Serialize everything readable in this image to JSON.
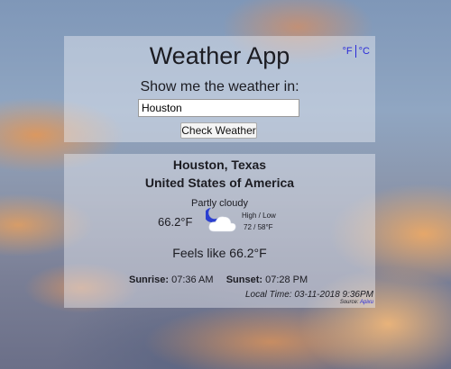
{
  "app": {
    "title": "Weather App",
    "prompt": "Show me the weather in:"
  },
  "units": {
    "fahrenheit": "°F",
    "celsius": "°C",
    "link_color": "#2a2ad8"
  },
  "search": {
    "value": "Houston",
    "button_label": "Check Weather"
  },
  "location": {
    "city_state": "Houston, Texas",
    "country": "United States of America"
  },
  "current": {
    "condition": "Partly cloudy",
    "temperature": "66.2°F",
    "icon": "partly-cloudy-night-icon",
    "high_low_label": "High / Low",
    "high_low_values": "72 / 58°F",
    "feels_like": "Feels like 66.2°F"
  },
  "sun": {
    "sunrise_label": "Sunrise:",
    "sunrise_time": "07:36 AM",
    "sunset_label": "Sunset:",
    "sunset_time": "07:28 PM"
  },
  "footer": {
    "local_time": "Local Time: 03-11-2018 9:36PM",
    "source_label": "Source:",
    "source_link": "Apixu"
  }
}
